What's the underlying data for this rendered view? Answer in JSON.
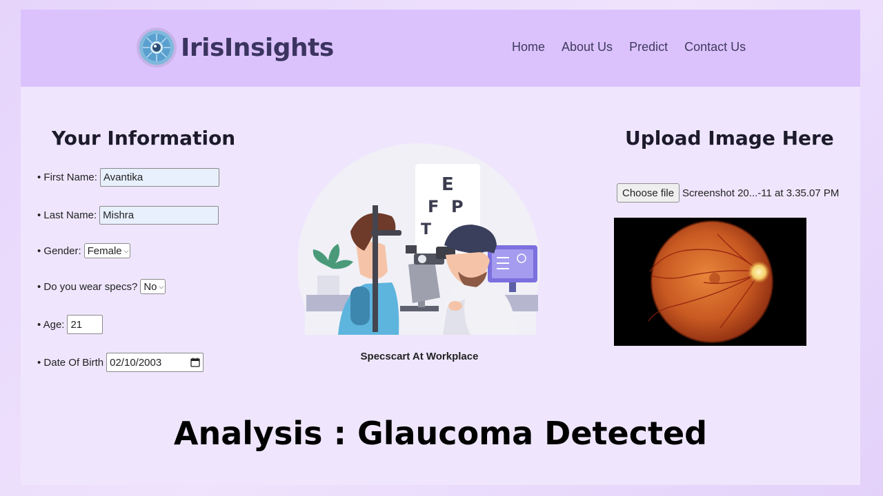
{
  "header": {
    "brand": "IrisInsights",
    "nav": [
      "Home",
      "About Us",
      "Predict",
      "Contact Us"
    ]
  },
  "info": {
    "heading": "Your Information",
    "first_name_label": "• First Name:",
    "first_name_value": "Avantika",
    "last_name_label": "• Last Name:",
    "last_name_value": "Mishra",
    "gender_label": "• Gender:",
    "gender_value": "Female",
    "specs_label": "• Do you wear specs?",
    "specs_value": "No",
    "age_label": "• Age:",
    "age_value": "21",
    "dob_label": "• Date Of Birth",
    "dob_value": "02/10/2003"
  },
  "illustration": {
    "caption": "Specscart At Workplace",
    "chart_letters": [
      "E",
      "F",
      "P",
      "T"
    ]
  },
  "upload": {
    "heading": "Upload Image Here",
    "button_label": "Choose file",
    "file_name": "Screenshot 20...-11 at 3.35.07 PM"
  },
  "result": {
    "text": "Analysis : Glaucoma Detected"
  },
  "colors": {
    "navbar": "#dcc2fd",
    "panel": "#efe6fd",
    "brand_text": "#3b3460"
  }
}
